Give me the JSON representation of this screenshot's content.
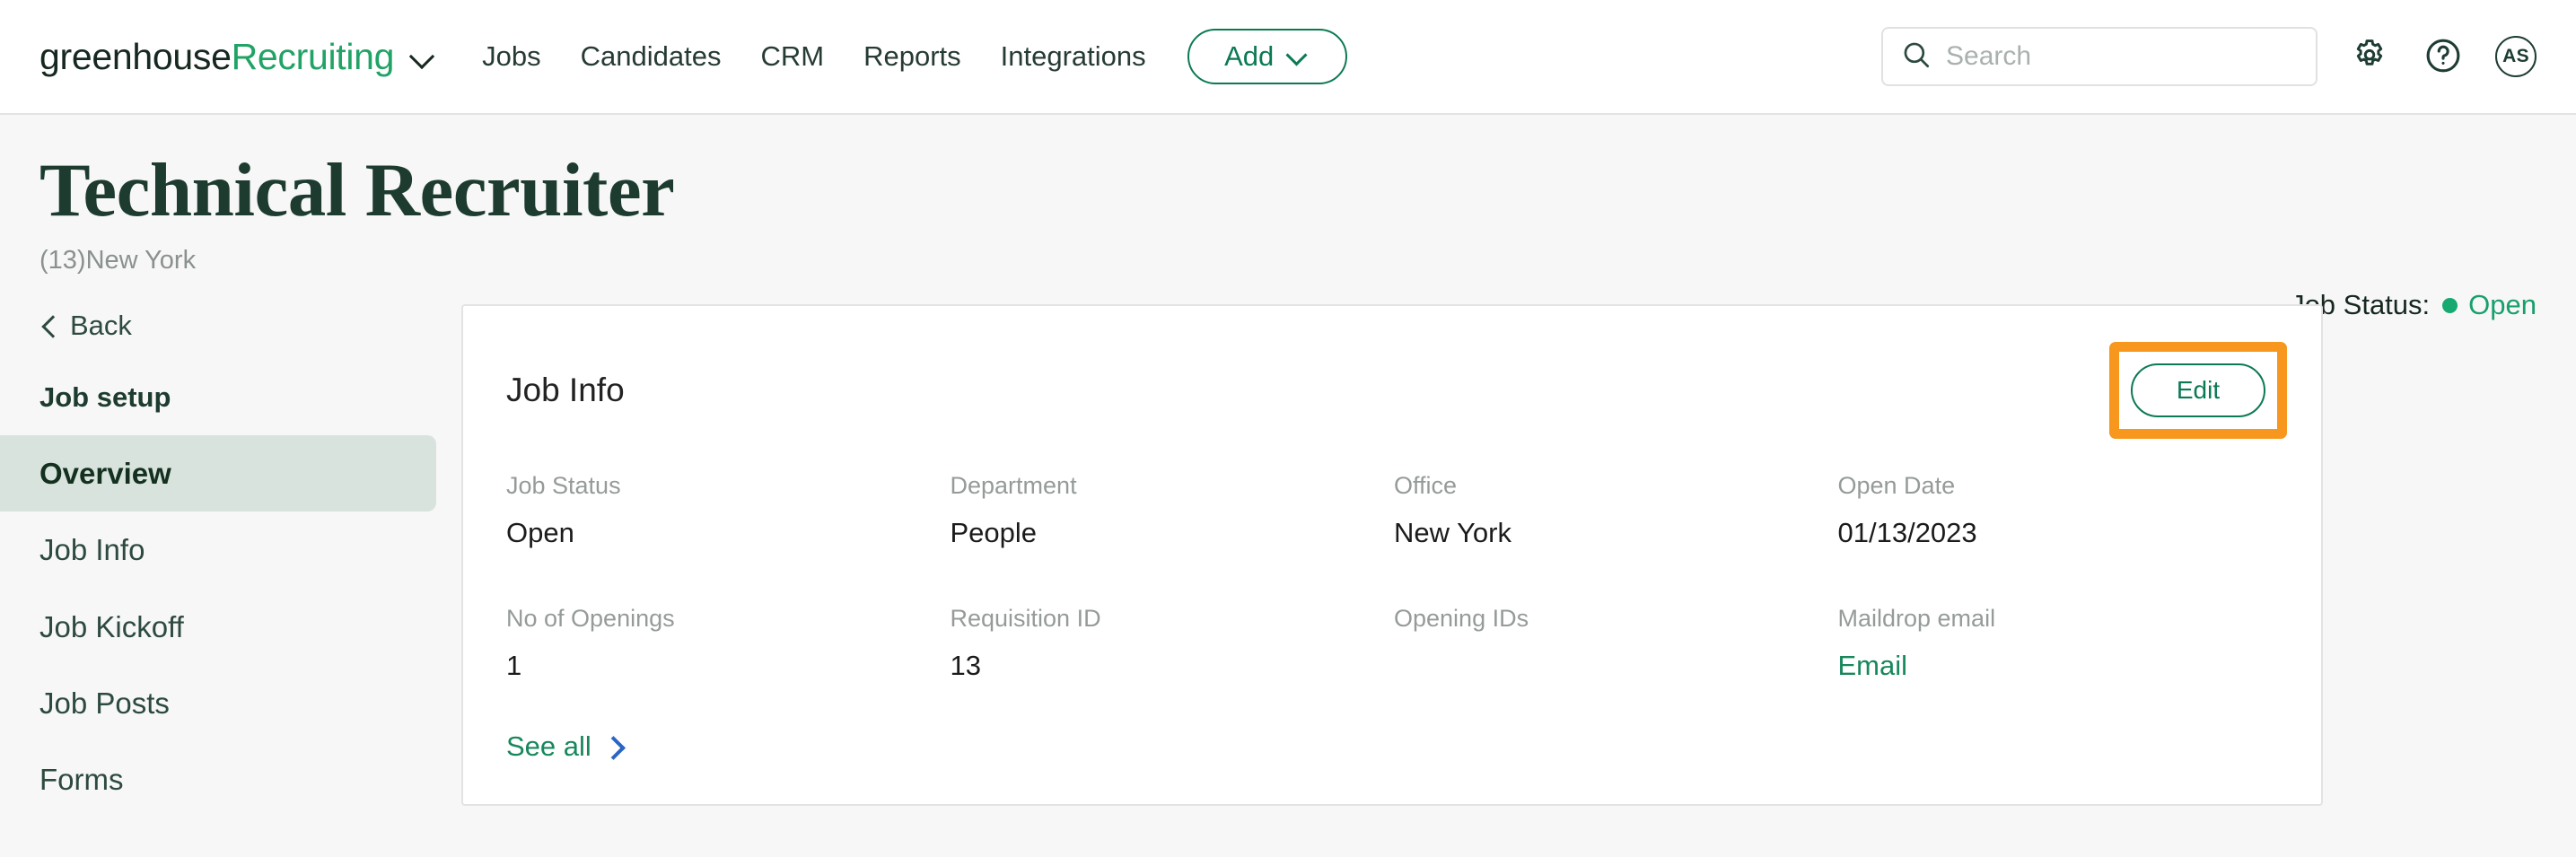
{
  "header": {
    "brand_primary": "greenhouse",
    "brand_secondary": "Recruiting",
    "nav": [
      {
        "label": "Jobs"
      },
      {
        "label": "Candidates"
      },
      {
        "label": "CRM"
      },
      {
        "label": "Reports"
      },
      {
        "label": "Integrations"
      }
    ],
    "add_button": "Add",
    "search": {
      "placeholder": "Search",
      "value": ""
    },
    "avatar_initials": "AS"
  },
  "page": {
    "title": "Technical Recruiter",
    "subtitle": "(13)New York",
    "job_status_label": "Job Status:",
    "job_status_value": "Open"
  },
  "sidebar": {
    "back_label": "Back",
    "section_title": "Job setup",
    "items": [
      {
        "label": "Overview",
        "active": true
      },
      {
        "label": "Job Info",
        "active": false
      },
      {
        "label": "Job Kickoff",
        "active": false
      },
      {
        "label": "Job Posts",
        "active": false
      },
      {
        "label": "Forms",
        "active": false
      }
    ]
  },
  "card": {
    "title": "Job Info",
    "edit_label": "Edit",
    "see_all_label": "See all",
    "fields": [
      {
        "label": "Job Status",
        "value": "Open"
      },
      {
        "label": "Department",
        "value": "People"
      },
      {
        "label": "Office",
        "value": "New York"
      },
      {
        "label": "Open Date",
        "value": "01/13/2023"
      },
      {
        "label": "No of Openings",
        "value": "1"
      },
      {
        "label": "Requisition ID",
        "value": "13"
      },
      {
        "label": "Opening IDs",
        "value": ""
      },
      {
        "label": "Maildrop email",
        "value": "Email",
        "is_link": true
      }
    ]
  },
  "colors": {
    "brand_green": "#21a366",
    "accent_green": "#0b7a52",
    "status_green": "#18a06c",
    "highlight_orange": "#f7971d",
    "link_blue": "#2b65c4",
    "page_bg": "#f7f7f7"
  },
  "icons": {
    "search": "search-icon",
    "gear": "gear-icon",
    "help": "help-icon",
    "chevron_down": "chevron-down-icon",
    "chevron_left": "chevron-left-icon",
    "chevron_right": "chevron-right-icon"
  }
}
